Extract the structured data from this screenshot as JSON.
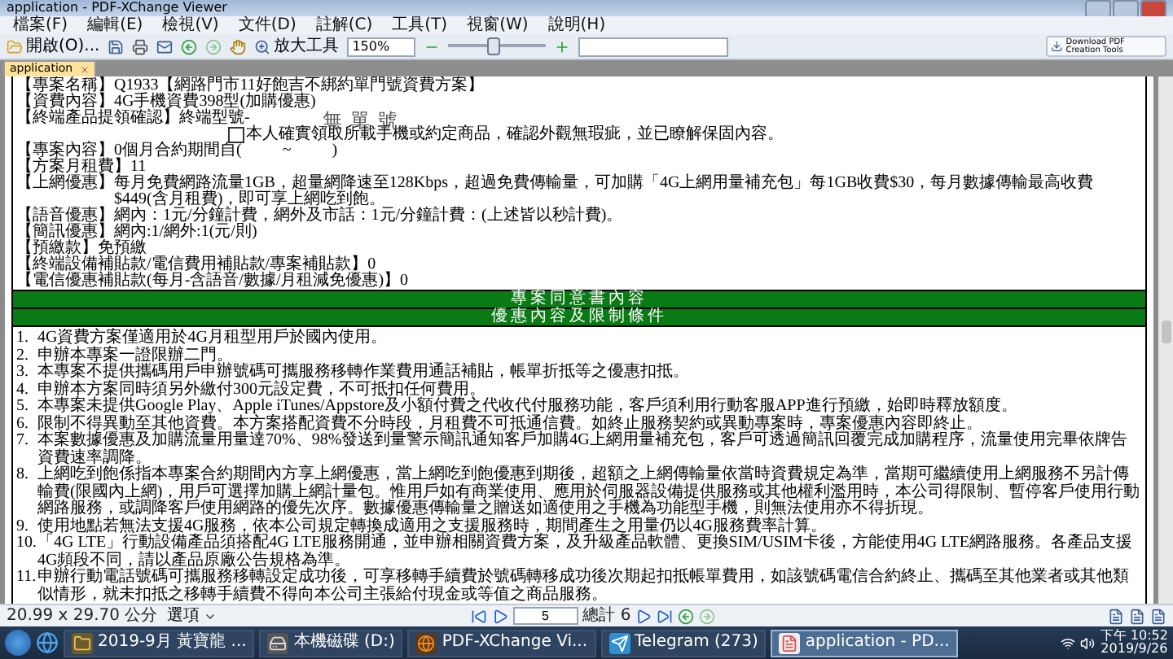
{
  "window": {
    "title": "application - PDF-XChange Viewer"
  },
  "menu": [
    "檔案(F)",
    "編輯(E)",
    "檢視(V)",
    "文件(D)",
    "註解(C)",
    "工具(T)",
    "視窗(W)",
    "說明(H)"
  ],
  "toolbar": {
    "open": "開啟(O)...",
    "zoom_tool": "放大工具",
    "zoom": "150%",
    "level": 0.45,
    "download": "Download PDF Creation Tools"
  },
  "tabs": [
    {
      "label": "application",
      "selected": true
    }
  ],
  "document": {
    "fields": [
      {
        "label": "【專案名稱】",
        "value": "Q1933【網路門市11好飽吉不綁約單門號資費方案】"
      },
      {
        "label": "【資費內容】",
        "value": "4G手機資費398型(加購優惠)"
      },
      {
        "label": "【終端產品提領確認】",
        "value": "終端型號-"
      },
      {
        "label": "【專案內容】",
        "value": "0個月合約期間自(          ~          )"
      },
      {
        "label": "【方案月租費】",
        "value": "11"
      },
      {
        "label": "【上網優惠】",
        "value": "每月免費網路流量1GB，超量網降速至128Kbps，超過免費傳輸量，可加購「4G上網用量補充包」每1GB收費$30，每月數據傳輸最高收費$449(含月租費)，即可享上網吃到飽。"
      },
      {
        "label": "【語音優惠】",
        "value": "網內：1元/分鐘計費，網外及市話：1元/分鐘計費：(上述皆以秒計費)。"
      },
      {
        "label": "【簡訊優惠】",
        "value": "網內:1/網外:1(元/則)"
      },
      {
        "label": "【預繳款】",
        "value": "免預繳"
      },
      {
        "label": "【終端設備補貼款/電信費用補貼款/專案補貼款】",
        "value": "0"
      },
      {
        "label": "【電信優惠補貼款(每月-含語音/數據/月租減免優惠)】",
        "value": "0"
      }
    ],
    "stamp": "無單號",
    "confirm": {
      "text": "本人確實領取所載手機或約定商品，確認外觀無瑕疵，並已瞭解保固內容。",
      "checked": false
    },
    "sections": [
      "專案同意書內容",
      "優惠內容及限制條件"
    ],
    "terms": [
      {
        "number": "1.",
        "text": "4G資費方案僅適用於4G月租型用戶於國內使用。"
      },
      {
        "number": "2.",
        "text": "申辦本專案一證限辦二門。"
      },
      {
        "number": "3.",
        "text": "本專案不提供攜碼用戶申辦號碼可攜服務移轉作業費用通話補貼，帳單折抵等之優惠扣抵。"
      },
      {
        "number": "4.",
        "text": "申辦本方案同時須另外繳付300元設定費，不可抵扣任何費用。"
      },
      {
        "number": "5.",
        "text": "本專案未提供Google Play、Apple iTunes/Appstore及小額付費之代收代付服務功能，客戶須利用行動客服APP進行預繳，始即時釋放額度。"
      },
      {
        "number": "6.",
        "text": "限制不得異動至其他資費。本方案搭配資費不分時段，月租費不可抵通信費。如終止服務契約或異動專案時，專案優惠內容即終止。"
      },
      {
        "number": "7.",
        "text": "本案數據優惠及加購流量用量達70%、98%發送到量警示簡訊通知客戶加購4G上網用量補充包，客戶可透過簡訊回覆完成加購程序，流量使用完畢依牌告資費速率調降。"
      },
      {
        "number": "8.",
        "text": "上網吃到飽係指本專案合約期間內方享上網優惠，當上網吃到飽優惠到期後，超額之上網傳輸量依當時資費規定為準，當期可繼續使用上網服務不另計傳輸費(限國內上網)，用戶可選擇加購上網計量包。惟用戶如有商業使用、應用於伺服器設備提供服務或其他權利濫用時，本公司得限制、暫停客戶使用行動網路服務，或調降客戶使用網路的優先次序。數據優惠傳輸量之贈送如適使用之手機為功能型手機，則無法使用亦不得折現。"
      },
      {
        "number": "9.",
        "text": "使用地點若無法支援4G服務，依本公司規定轉換成適用之支援服務時，期間產生之用量仍以4G服務費率計算。"
      },
      {
        "number": "10.",
        "text": "「4G LTE」行動設備產品須搭配4G LTE服務開通，並申辦相關資費方案，及升級產品軟體、更換SIM/USIM卡後，方能使用4G LTE網路服務。各產品支援4G頻段不同，請以產品原廠公告規格為準。"
      },
      {
        "number": "11.",
        "text": "申辦行動電話號碼可攜服務移轉設定成功後，可享移轉手續費於號碼轉移成功後次期起扣抵帳單費用，如該號碼電信合約終止、攜碼至其他業者或其他類似情形，就未扣抵之移轉手續費不得向本公司主張給付現金或等值之商品服務。"
      }
    ]
  },
  "status": {
    "page_size": "20.99 x 29.70 公分",
    "options": "選項",
    "page": "5",
    "page_total": "總計 6"
  },
  "taskbar": {
    "items": [
      {
        "kind": "folder",
        "label": "2019-9月 黃寶龍 ...",
        "selected": false
      },
      {
        "kind": "drive",
        "label": "本機磁碟 (D:)",
        "selected": false
      },
      {
        "kind": "browser",
        "label": "PDF-XChange Vi...",
        "selected": false
      },
      {
        "kind": "chat",
        "label": "Telegram (273)",
        "selected": false
      },
      {
        "kind": "pdf",
        "label": "application - PD...",
        "selected": true
      }
    ],
    "time": "下午 10:52",
    "date": "2019/9/26"
  }
}
